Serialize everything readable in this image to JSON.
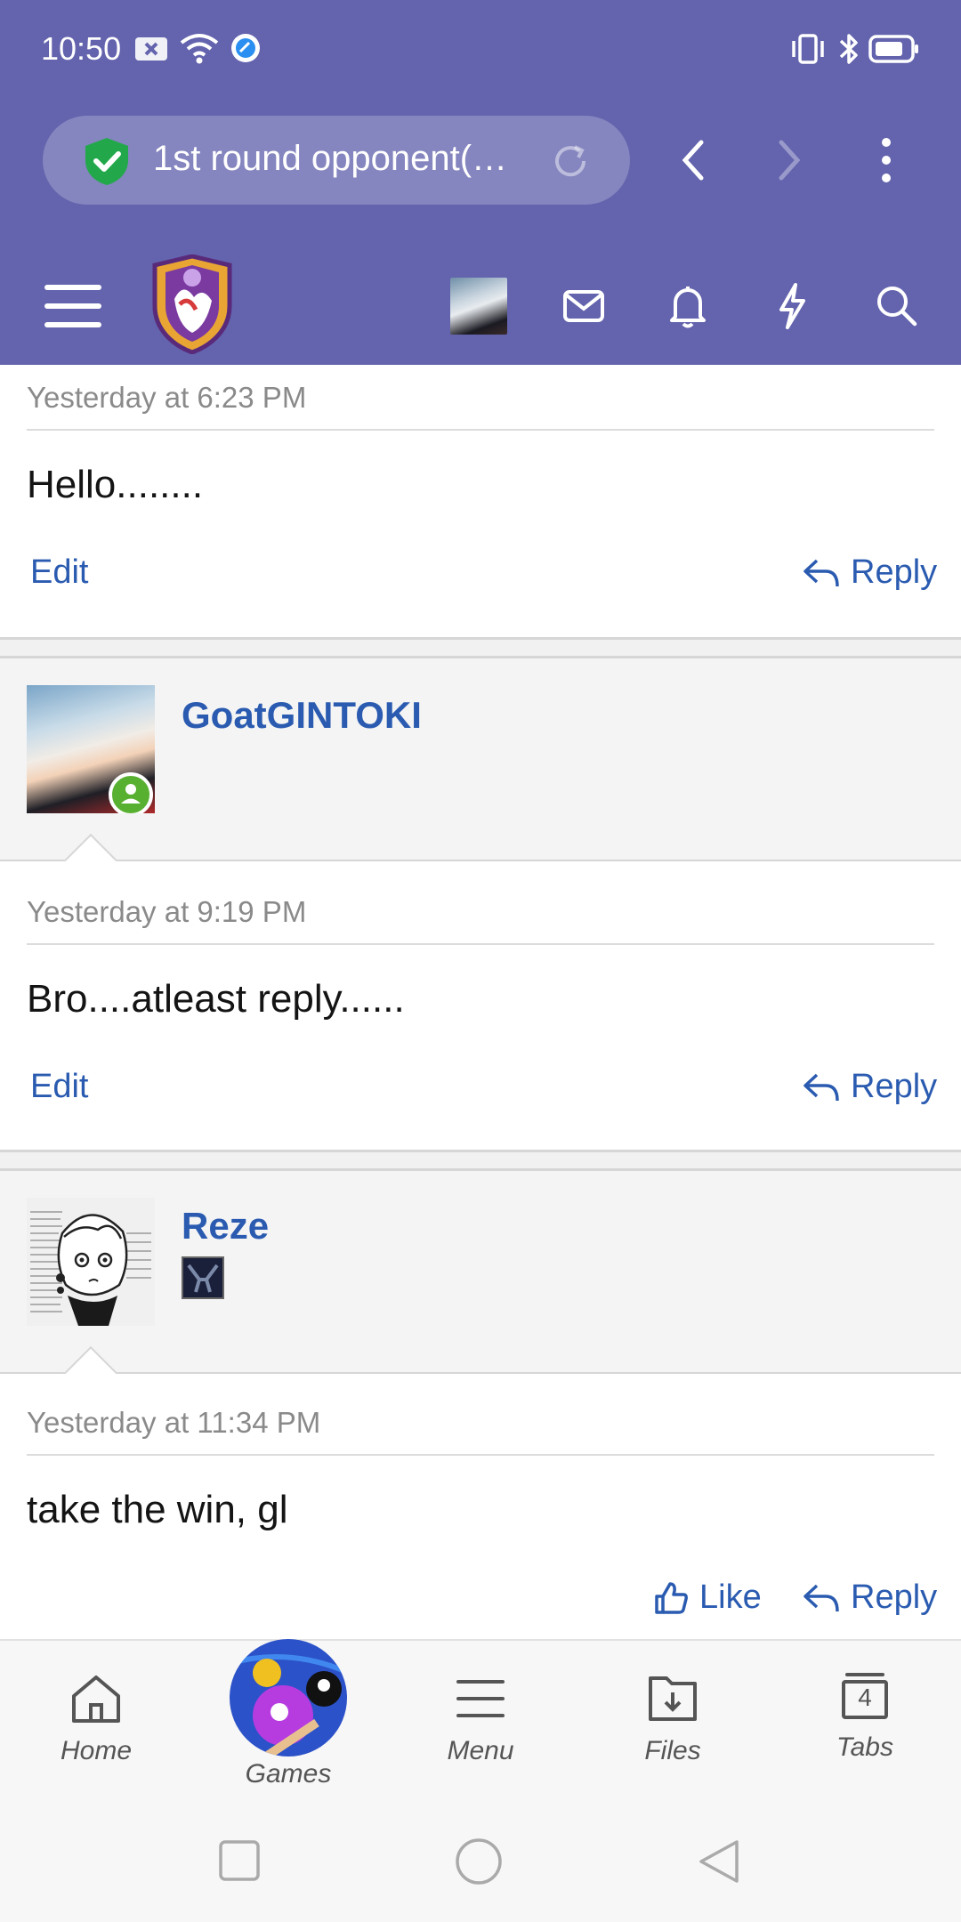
{
  "status_bar": {
    "time": "10:50"
  },
  "browser": {
    "url_title": "1st round opponent(…",
    "secure_icon": "shield-check-icon"
  },
  "forum_toolbar": {
    "menu_icon": "hamburger-icon",
    "logo": "forum-logo",
    "icons": [
      "avatar",
      "mail-icon",
      "bell-icon",
      "lightning-icon",
      "search-icon"
    ]
  },
  "posts": [
    {
      "timestamp": "Yesterday at 6:23 PM",
      "message": "Hello........",
      "left_action": "Edit",
      "reply_label": "Reply"
    },
    {
      "username": "GoatGINTOKI",
      "timestamp": "Yesterday at 9:19 PM",
      "message": "Bro....atleast reply......",
      "left_action": "Edit",
      "reply_label": "Reply"
    },
    {
      "username": "Reze",
      "timestamp": "Yesterday at 11:34 PM",
      "message": "take the win, gl",
      "like_label": "Like",
      "reply_label": "Reply"
    }
  ],
  "bottom_nav": {
    "items": [
      {
        "label": "Home",
        "icon": "home-icon"
      },
      {
        "label": "Games",
        "icon": "billiard-ball-icon"
      },
      {
        "label": "Menu",
        "icon": "menu-lines-icon"
      },
      {
        "label": "Files",
        "icon": "folder-download-icon"
      },
      {
        "label": "Tabs",
        "icon": "tabs-icon",
        "count": "4"
      }
    ]
  },
  "colors": {
    "header": "#6363ae",
    "link": "#2a5bb0",
    "online": "#58b030"
  }
}
